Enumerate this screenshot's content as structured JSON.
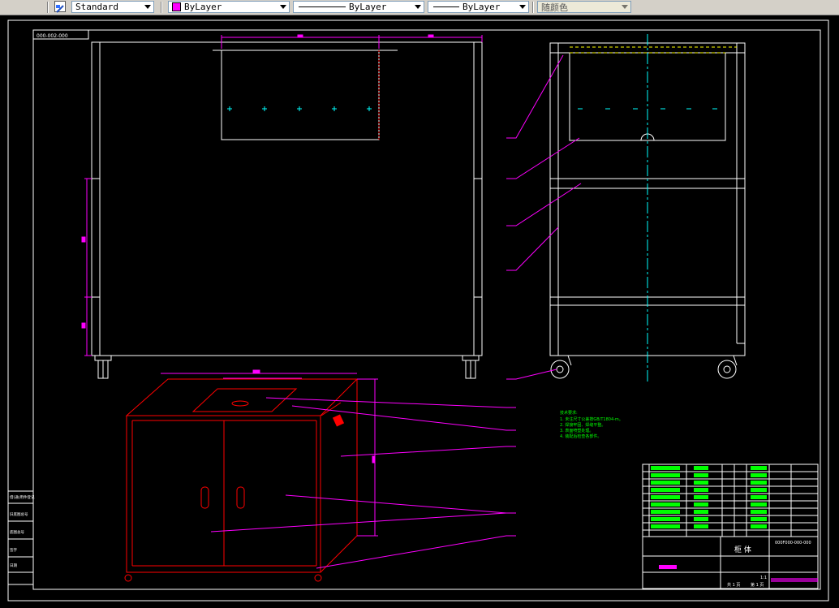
{
  "toolbar": {
    "textstyle_value": "Standard",
    "layer_color_value": "ByLayer",
    "linetype_value": "ByLayer",
    "lineweight_value": "ByLayer",
    "plotstyle_value": "随颜色",
    "colors": {
      "layer_swatch": "#ff00ff"
    }
  },
  "drawing": {
    "drawing_code": "000-002-000",
    "notes_title": "技术要求:",
    "notes": [
      "1. 未注尺寸公差按GB/T1804-m。",
      "2. 焊接牢固、焊缝平整。",
      "3. 表面喷塑处理。",
      "4. 装配后检查各部件。"
    ],
    "title_block": {
      "name": "柜 体",
      "drawing_no": "000F000-000-000",
      "sheet_count": "共 1 页",
      "sheet_no": "第 1 页",
      "scale": "1:1"
    },
    "side_labels": [
      "借(通)用件登记",
      "旧底图总号",
      "底图总号",
      "签字",
      "日期"
    ],
    "colors": {
      "outline": "#ffffff",
      "dimension": "#ff00ff",
      "centerline": "#00ffff",
      "hidden": "#ffff00",
      "iso_view": "#ff0000",
      "notes": "#00ff00"
    }
  }
}
